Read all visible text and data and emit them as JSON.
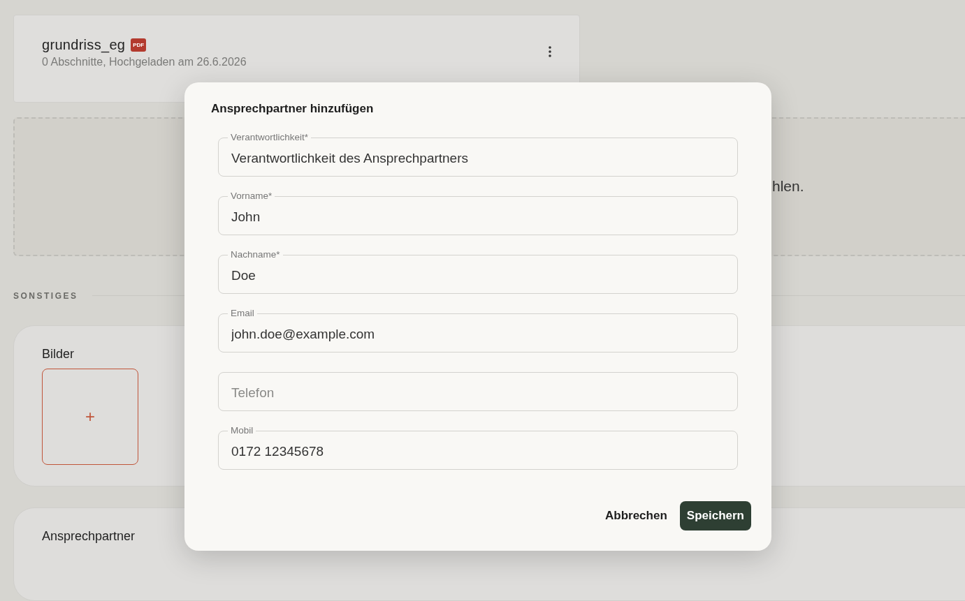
{
  "file": {
    "name": "grundriss_eg",
    "badge": "PDF",
    "meta": "0 Abschnitte, Hochgeladen am 26.6.2026"
  },
  "dropzone": {
    "text": "hlen."
  },
  "section": {
    "title": "SONSTIGES"
  },
  "cards": [
    {
      "kind": "images",
      "title": "Bilder",
      "add": "+"
    },
    {
      "kind": "contacts",
      "title": "Ansprechpartner"
    }
  ],
  "dialog": {
    "title": "Ansprechpartner hinzufügen",
    "fields": [
      {
        "label": "Verantwortlichkeit*",
        "value": "Verantwortlichkeit des Ansprechpartners"
      },
      {
        "label": "Vorname*",
        "value": "John"
      },
      {
        "label": "Nachname*",
        "value": "Doe"
      },
      {
        "label": "Email",
        "value": "john.doe@example.com"
      },
      {
        "placeholder": "Telefon"
      },
      {
        "label": "Mobil",
        "value": "0172 12345678"
      }
    ],
    "buttons": [
      {
        "kind": "text",
        "label": "Abbrechen"
      },
      {
        "kind": "primary",
        "label": "Speichern"
      }
    ]
  }
}
